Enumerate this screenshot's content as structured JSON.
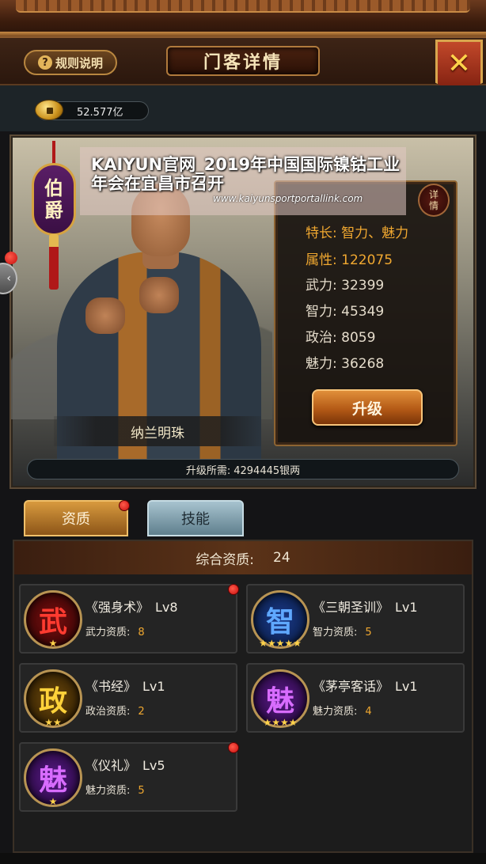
{
  "header": {
    "rules_label": "规则说明",
    "title": "门客详情",
    "close_icon": "close-x-icon"
  },
  "currency": {
    "amount": "52.577亿",
    "icon": "coin-icon"
  },
  "banner": {
    "title": "KAIYUN官网_2019年中国国际镍钴工业年会在宜昌市召开",
    "url": "www.kaiyunsportportallink.com"
  },
  "character": {
    "rank": [
      "伯",
      "爵"
    ],
    "name": "纳兰明珠",
    "detail_tag": [
      "详",
      "情"
    ],
    "stats": {
      "specialty_label": "特长:",
      "specialty_value": "智力、魅力",
      "attr_label": "属性:",
      "attr_value": "122075",
      "force_label": "武力:",
      "force_value": "32399",
      "intellect_label": "智力:",
      "intellect_value": "45349",
      "politics_label": "政治:",
      "politics_value": "8059",
      "charm_label": "魅力:",
      "charm_value": "36268"
    },
    "upgrade_label": "升级",
    "cost_label": "升级所需:",
    "cost_value": "4294445银两"
  },
  "tabs": {
    "qualities": "资质",
    "skills": "技能"
  },
  "qualities": {
    "total_label": "综合资质:",
    "total_value": "24",
    "cards": [
      {
        "glyph": "武",
        "stars": "★",
        "name": "《强身术》",
        "level": "Lv8",
        "attr_label": "武力资质:",
        "attr_value": "8"
      },
      {
        "glyph": "智",
        "stars": "★★★★★",
        "name": "《三朝圣训》",
        "level": "Lv1",
        "attr_label": "智力资质:",
        "attr_value": "5"
      },
      {
        "glyph": "政",
        "stars": "★★",
        "name": "《书经》",
        "level": "Lv1",
        "attr_label": "政治资质:",
        "attr_value": "2"
      },
      {
        "glyph": "魅",
        "stars": "★★★★",
        "name": "《茅亭客话》",
        "level": "Lv1",
        "attr_label": "魅力资质:",
        "attr_value": "4"
      },
      {
        "glyph": "魅",
        "stars": "★",
        "name": "《仪礼》",
        "level": "Lv5",
        "attr_label": "魅力资质:",
        "attr_value": "5"
      }
    ]
  },
  "colors": {
    "accent_gold": "#f0a830",
    "notification_red": "#e01818"
  }
}
